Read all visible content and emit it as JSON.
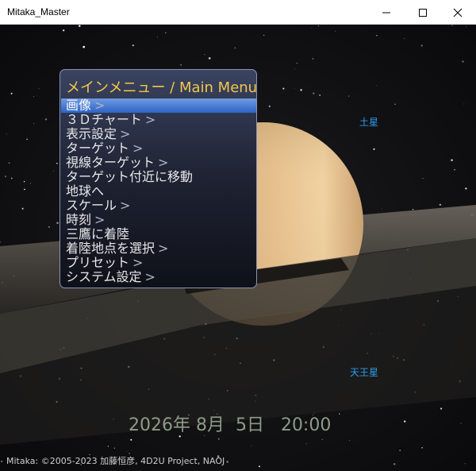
{
  "window": {
    "title": "Mitaka_Master"
  },
  "menu": {
    "title": "メインメニュー / Main Menu",
    "items": [
      {
        "label": "画像",
        "arrow": ">",
        "selected": true
      },
      {
        "label": "３Ｄチャート",
        "arrow": ">"
      },
      {
        "label": "表示設定",
        "arrow": ">"
      },
      {
        "label": "ターゲット",
        "arrow": ">"
      },
      {
        "label": "視線ターゲット",
        "arrow": ">"
      },
      {
        "label": "ターゲット付近に移動",
        "arrow": ""
      },
      {
        "label": "地球へ",
        "arrow": ""
      },
      {
        "label": "スケール",
        "arrow": ">"
      },
      {
        "label": "時刻",
        "arrow": ">"
      },
      {
        "label": "三鷹に着陸",
        "arrow": ""
      },
      {
        "label": "着陸地点を選択",
        "arrow": ">"
      },
      {
        "label": "プリセット",
        "arrow": ">"
      },
      {
        "label": "システム設定",
        "arrow": ">"
      }
    ]
  },
  "labels": {
    "saturn": "土星",
    "uranus": "天王星"
  },
  "datetime": "2026年 8月  5日   20:00",
  "credit": "Mitaka: ©2005-2023 加藤恒彦, 4D2U Project, NAOJ",
  "colors": {
    "menu_title": "#f2c84a",
    "selection": "#3a72d6",
    "planet_label": "#2a9ef0",
    "datetime": "#8d9a87"
  }
}
